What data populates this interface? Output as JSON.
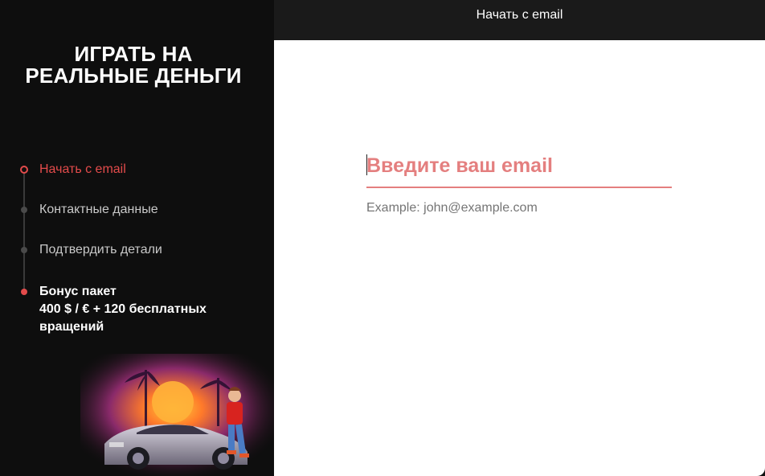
{
  "sidebar": {
    "title_line1": "ИГРАТЬ НА",
    "title_line2": "РЕАЛЬНЫЕ ДЕНЬГИ",
    "steps": [
      {
        "label": "Начать с email",
        "state": "active"
      },
      {
        "label": "Контактные данные",
        "state": "pending"
      },
      {
        "label": "Подтвердить детали",
        "state": "pending"
      }
    ],
    "bonus": {
      "line1": "Бонус пакет",
      "line2": "400 $ / € + 120 бесплатных",
      "line3": "вращений"
    }
  },
  "header": {
    "title": "Начать с email"
  },
  "form": {
    "email_placeholder": "Введите ваш email",
    "email_value": "",
    "hint": "Example: john@example.com"
  },
  "colors": {
    "accent": "#e34b4b",
    "input_accent": "#e47f7f",
    "sidebar_bg": "#0e0e0e",
    "header_bg": "#1a1a1a"
  }
}
